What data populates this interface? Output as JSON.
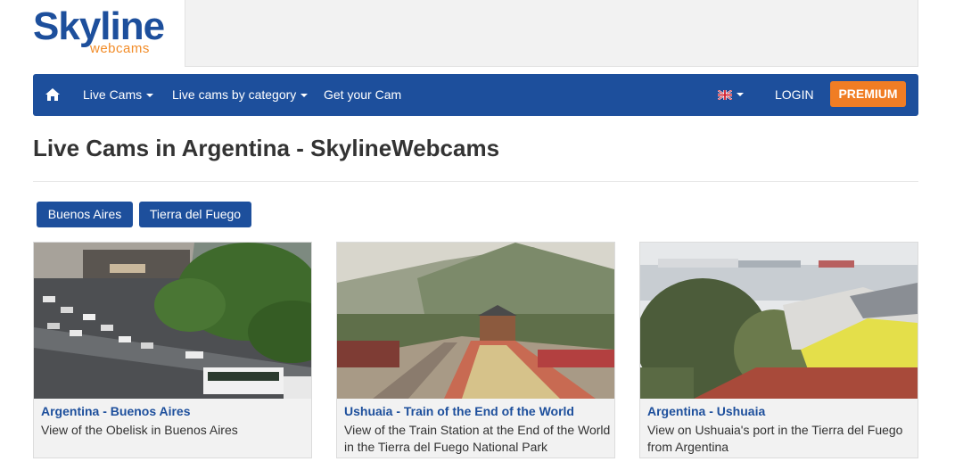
{
  "header": {
    "logo_brand": "Skyline",
    "logo_sub": "webcams"
  },
  "nav": {
    "live_cams": "Live Cams",
    "by_category": "Live cams by category",
    "get_cam": "Get your Cam",
    "login": "LOGIN",
    "premium": "PREMIUM"
  },
  "page": {
    "title": "Live Cams in Argentina - SkylineWebcams"
  },
  "regions": [
    "Buenos Aires",
    "Tierra del Fuego"
  ],
  "cards": [
    {
      "title": "Argentina - Buenos Aires",
      "description": "View of the Obelisk in Buenos Aires"
    },
    {
      "title": "Ushuaia - Train of the End of the World",
      "description": "View of the Train Station at the End of the World in the Tierra del Fuego National Park"
    },
    {
      "title": "Argentina - Ushuaia",
      "description": "View on Ushuaia's port in the Tierra del Fuego from Argentina"
    }
  ],
  "colors": {
    "brand_blue": "#1d4f9c",
    "accent_orange": "#f07d24"
  },
  "icons": [
    "home-icon",
    "uk-flag-icon",
    "caret-down-icon"
  ]
}
